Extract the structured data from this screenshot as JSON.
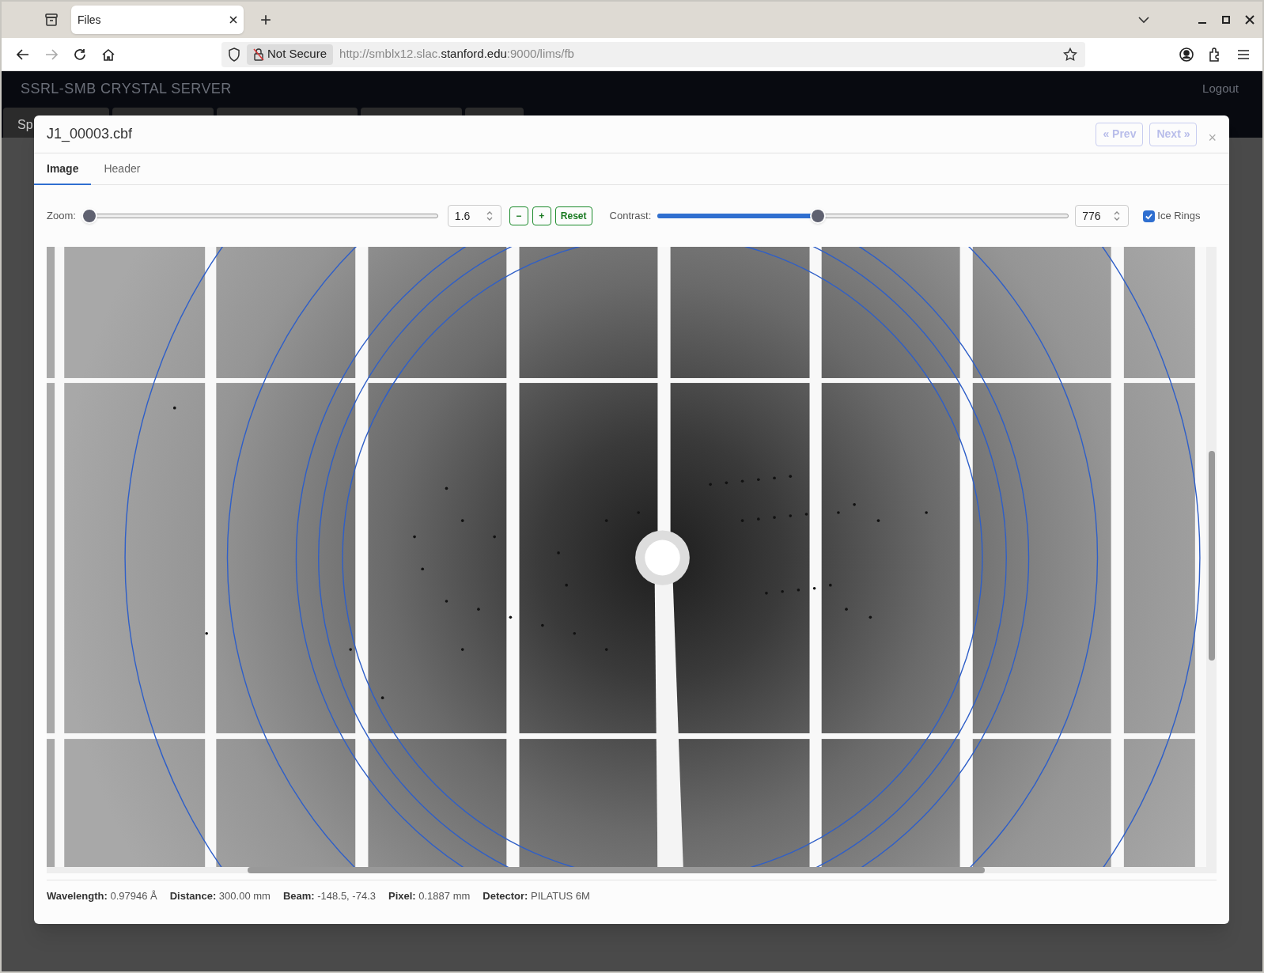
{
  "browser": {
    "tabs": [
      {
        "title": "Files",
        "selected": true
      }
    ],
    "new_tab": "+",
    "address": {
      "security": "Not Secure",
      "url_prefix": "http://smblx12.slac.",
      "url_domain": "stanford.edu",
      "url_suffix": ":9000/lims/fb"
    }
  },
  "app": {
    "title": "SSRL-SMB CRYSTAL SERVER",
    "logout": "Logout",
    "tabs": [
      {
        "label": "Sp"
      }
    ]
  },
  "dialog": {
    "title": "J1_00003.cbf",
    "prev": {
      "label": "« Prev",
      "disabled": true
    },
    "next": {
      "label": "Next »",
      "disabled": true
    },
    "close": "×",
    "tabs": [
      {
        "label": "Image",
        "selected": true
      },
      {
        "label": "Header",
        "selected": false
      }
    ],
    "zoom": {
      "label": "Zoom:",
      "level": 0.02,
      "value": "1.6"
    },
    "buttons": [
      "−",
      "+",
      "Reset"
    ],
    "contrast": {
      "label": "Contrast:",
      "level": 0.39,
      "value": "776"
    },
    "ice_rings": {
      "label": "Ice Rings",
      "checked": true
    },
    "info": [
      {
        "label": "Wavelength:",
        "value": "0.97946 Å"
      },
      {
        "label": "Distance:",
        "value": "300.00 mm"
      },
      {
        "label": "Beam:",
        "value": "-148.5, -74.3"
      },
      {
        "label": "Pixel:",
        "value": "0.1887 mm"
      },
      {
        "label": "Detector:",
        "value": "PILATUS 6M"
      }
    ]
  }
}
